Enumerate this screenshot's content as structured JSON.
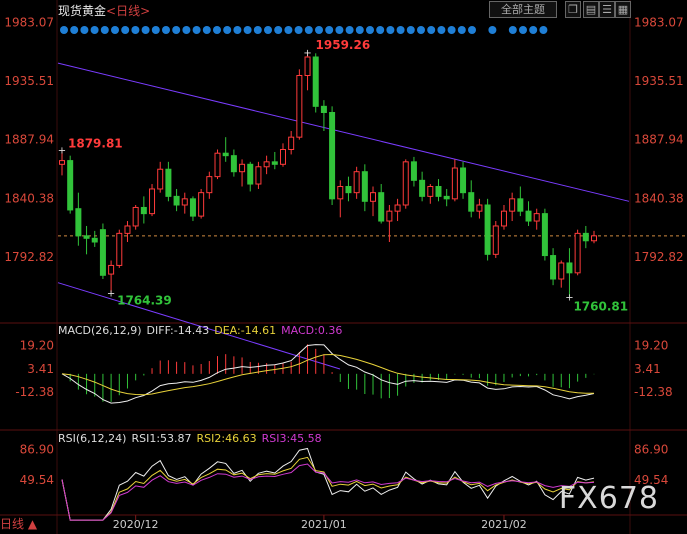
{
  "header": {
    "title": "现货黄金",
    "timeframe": "<日线>",
    "theme_label": "全部主题"
  },
  "footer": {
    "period": "日线 ▲"
  },
  "watermark": "FX678",
  "colors": {
    "up": "#ff3b3b",
    "down": "#31c33a",
    "channel": "#7a3cff",
    "price_line": "#d08a40",
    "dots": "#1f7fd6"
  },
  "chart_data": [
    {
      "type": "candlestick",
      "title": "现货黄金",
      "y_ticks": [
        "1983.07",
        "1935.51",
        "1887.94",
        "1840.38",
        "1792.82"
      ],
      "ylim": [
        1745,
        1985
      ],
      "x_ticks": [
        "2020/12",
        "2021/01",
        "2021/02"
      ],
      "annotations": [
        {
          "text": "1959.26",
          "type": "high"
        },
        {
          "text": "1879.81",
          "type": "high"
        },
        {
          "text": "1764.39",
          "type": "low"
        },
        {
          "text": "1760.81",
          "type": "low"
        }
      ],
      "current_price": 1810,
      "ohlc": [
        [
          1868,
          1880,
          1859,
          1871
        ],
        [
          1871,
          1875,
          1828,
          1831
        ],
        [
          1832,
          1845,
          1802,
          1810
        ],
        [
          1810,
          1818,
          1795,
          1808
        ],
        [
          1808,
          1814,
          1801,
          1805
        ],
        [
          1815,
          1820,
          1775,
          1778
        ],
        [
          1779,
          1790,
          1764,
          1786
        ],
        [
          1786,
          1815,
          1784,
          1812
        ],
        [
          1812,
          1822,
          1805,
          1818
        ],
        [
          1818,
          1835,
          1815,
          1833
        ],
        [
          1833,
          1842,
          1820,
          1828
        ],
        [
          1828,
          1852,
          1826,
          1848
        ],
        [
          1848,
          1870,
          1845,
          1864
        ],
        [
          1864,
          1870,
          1838,
          1842
        ],
        [
          1842,
          1848,
          1830,
          1835
        ],
        [
          1835,
          1845,
          1828,
          1840
        ],
        [
          1840,
          1842,
          1822,
          1826
        ],
        [
          1826,
          1848,
          1824,
          1845
        ],
        [
          1845,
          1862,
          1840,
          1858
        ],
        [
          1858,
          1880,
          1856,
          1877
        ],
        [
          1877,
          1890,
          1870,
          1875
        ],
        [
          1875,
          1880,
          1858,
          1862
        ],
        [
          1862,
          1872,
          1850,
          1868
        ],
        [
          1868,
          1870,
          1846,
          1852
        ],
        [
          1852,
          1870,
          1848,
          1866
        ],
        [
          1866,
          1875,
          1860,
          1870
        ],
        [
          1870,
          1878,
          1864,
          1868
        ],
        [
          1868,
          1885,
          1866,
          1880
        ],
        [
          1880,
          1895,
          1876,
          1890
        ],
        [
          1890,
          1945,
          1888,
          1940
        ],
        [
          1940,
          1959,
          1928,
          1955
        ],
        [
          1955,
          1958,
          1910,
          1915
        ],
        [
          1915,
          1920,
          1895,
          1910
        ],
        [
          1910,
          1915,
          1835,
          1840
        ],
        [
          1840,
          1855,
          1825,
          1850
        ],
        [
          1850,
          1858,
          1838,
          1845
        ],
        [
          1845,
          1866,
          1840,
          1862
        ],
        [
          1862,
          1868,
          1830,
          1838
        ],
        [
          1838,
          1850,
          1826,
          1845
        ],
        [
          1845,
          1852,
          1820,
          1822
        ],
        [
          1822,
          1835,
          1805,
          1830
        ],
        [
          1830,
          1840,
          1822,
          1835
        ],
        [
          1835,
          1872,
          1832,
          1870
        ],
        [
          1870,
          1874,
          1850,
          1855
        ],
        [
          1855,
          1862,
          1838,
          1842
        ],
        [
          1842,
          1852,
          1836,
          1850
        ],
        [
          1850,
          1856,
          1838,
          1842
        ],
        [
          1842,
          1848,
          1834,
          1840
        ],
        [
          1840,
          1872,
          1838,
          1865
        ],
        [
          1865,
          1870,
          1840,
          1845
        ],
        [
          1845,
          1855,
          1825,
          1830
        ],
        [
          1830,
          1840,
          1824,
          1835
        ],
        [
          1835,
          1840,
          1790,
          1795
        ],
        [
          1795,
          1822,
          1792,
          1818
        ],
        [
          1818,
          1835,
          1815,
          1830
        ],
        [
          1830,
          1845,
          1822,
          1840
        ],
        [
          1840,
          1850,
          1826,
          1830
        ],
        [
          1830,
          1838,
          1818,
          1822
        ],
        [
          1822,
          1832,
          1815,
          1828
        ],
        [
          1828,
          1832,
          1790,
          1794
        ],
        [
          1794,
          1800,
          1770,
          1775
        ],
        [
          1775,
          1790,
          1768,
          1788
        ],
        [
          1788,
          1800,
          1761,
          1780
        ],
        [
          1780,
          1815,
          1778,
          1812
        ],
        [
          1812,
          1818,
          1800,
          1806
        ],
        [
          1806,
          1814,
          1804,
          1810
        ]
      ]
    },
    {
      "type": "bar+line",
      "title": "MACD",
      "params": "MACD(26,12,9)",
      "labels": {
        "diff": "DIFF:-14.43",
        "dea": "DEA:-14.61",
        "macd": "MACD:0.36"
      },
      "y_ticks": [
        "19.20",
        "3.41",
        "-12.38"
      ],
      "ylim": [
        -30,
        25
      ]
    },
    {
      "type": "line",
      "title": "RSI",
      "params": "RSI(6,12,24)",
      "labels": {
        "rsi1": "RSI1:53.87",
        "rsi2": "RSI2:46.63",
        "rsi3": "RSI3:45.58"
      },
      "y_ticks": [
        "86.90",
        "49.54"
      ],
      "ylim": [
        10,
        95
      ]
    }
  ]
}
